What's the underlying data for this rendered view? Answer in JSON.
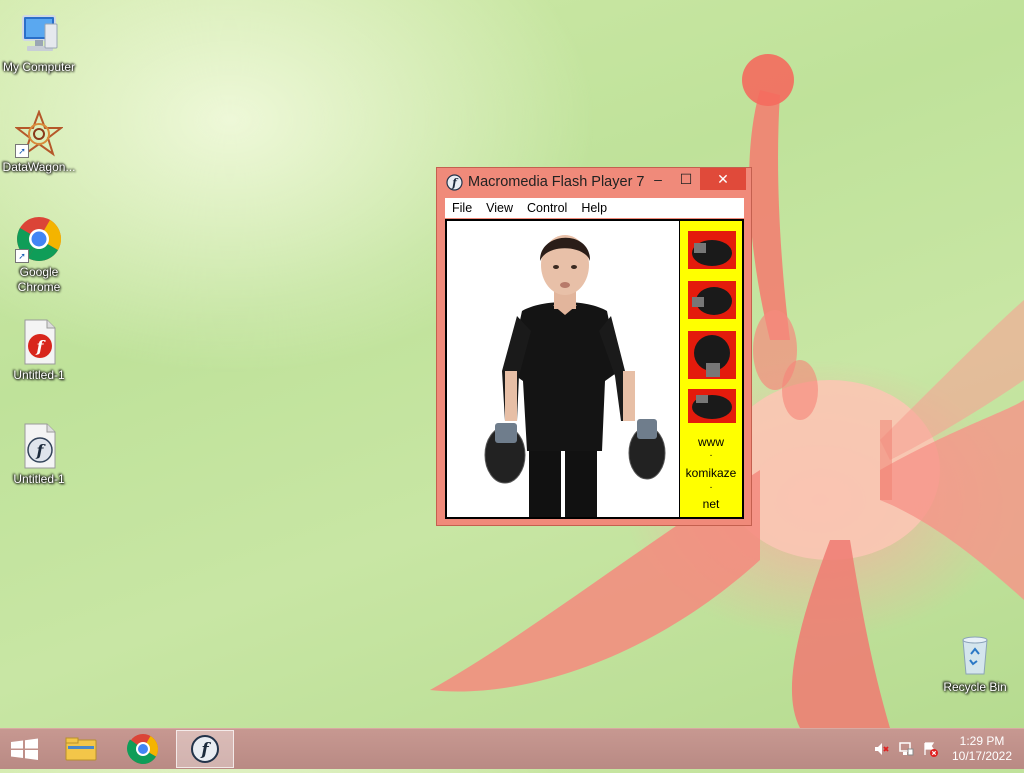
{
  "desktop": {
    "icons": [
      {
        "label": "My Computer",
        "icon": "computer-icon"
      },
      {
        "label": "DataWagon...",
        "icon": "datawagon-icon"
      },
      {
        "label": "Google Chrome",
        "icon": "chrome-icon"
      },
      {
        "label": "Untitled-1",
        "icon": "flash-document-icon"
      },
      {
        "label": "Untitled-1",
        "icon": "flash-player-document-icon"
      },
      {
        "label": "Recycle Bin",
        "icon": "recycle-bin-icon"
      }
    ]
  },
  "window": {
    "title": "Macromedia Flash Player 7",
    "controls": {
      "minimize": "–",
      "maximize": "☐",
      "close": "✕"
    },
    "menu": [
      "File",
      "View",
      "Control",
      "Help"
    ],
    "content": {
      "sidebar_text": [
        "www",
        ".",
        "komikaze",
        ".",
        "net"
      ]
    },
    "colors": {
      "frame": "#f08a7a",
      "close": "#e04a3a",
      "sidebar": "#ffff00",
      "thumb_bg": "#e41b0c"
    }
  },
  "taskbar": {
    "apps": [
      {
        "icon": "windows-start-icon"
      },
      {
        "icon": "file-explorer-icon"
      },
      {
        "icon": "chrome-icon"
      },
      {
        "icon": "flash-player-icon",
        "active": true
      }
    ],
    "tray": [
      {
        "icon": "speaker-muted-icon"
      },
      {
        "icon": "network-icon"
      },
      {
        "icon": "action-center-icon"
      }
    ],
    "time": "1:29 PM",
    "date": "10/17/2022"
  }
}
